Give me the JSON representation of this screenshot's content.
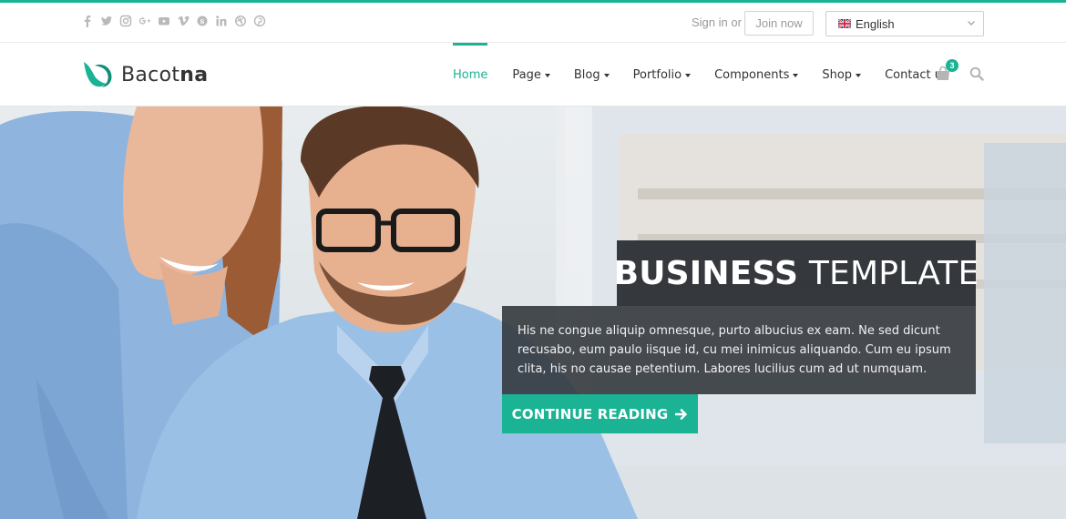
{
  "topbar": {
    "socials": [
      {
        "name": "facebook",
        "glyph": "f"
      },
      {
        "name": "twitter",
        "glyph": "t"
      },
      {
        "name": "instagram",
        "glyph": "ig"
      },
      {
        "name": "google-plus",
        "glyph": "G+"
      },
      {
        "name": "youtube",
        "glyph": "yt"
      },
      {
        "name": "vimeo",
        "glyph": "v"
      },
      {
        "name": "skype",
        "glyph": "s"
      },
      {
        "name": "linkedin",
        "glyph": "in"
      },
      {
        "name": "dribbble",
        "glyph": "d"
      },
      {
        "name": "pinterest",
        "glyph": "p"
      }
    ],
    "signin_label": "Sign in",
    "or_label": "or",
    "joinnow_label": "Join now",
    "language_label": "English"
  },
  "header": {
    "brand_light": "Bacot",
    "brand_bold": "na",
    "nav": [
      {
        "label": "Home"
      },
      {
        "label": "Page"
      },
      {
        "label": "Blog"
      },
      {
        "label": "Portfolio"
      },
      {
        "label": "Components"
      },
      {
        "label": "Shop"
      },
      {
        "label": "Contact us"
      }
    ],
    "cart_count": "3"
  },
  "hero": {
    "title_bold": "BUSINESS",
    "title_light": "TEMPLATE",
    "description": "His ne congue aliquip omnesque, purto albucius ex eam. Ne sed dicunt recusabo, eum paulo iisque id, cu mei inimicus aliquando. Cum eu ipsum clita, his no causae petentium. Labores lucilius cum ad ut numquam.",
    "cta_label": "CONTINUE READING"
  },
  "colors": {
    "accent": "#1ab394",
    "dark_overlay": "#282c32"
  }
}
